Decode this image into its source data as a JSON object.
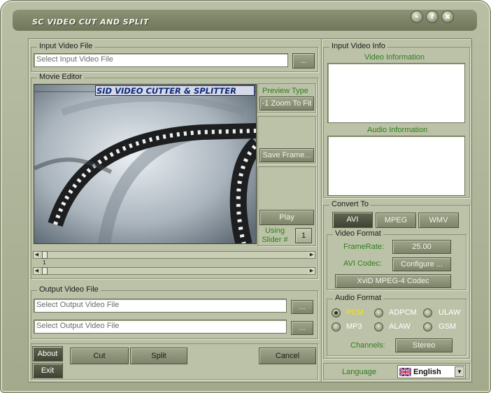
{
  "window": {
    "title": "SC VIDEO CUT AND SPLIT",
    "controls": {
      "minimize": "-",
      "help": "?",
      "close": "x"
    }
  },
  "input": {
    "group_label": "Input Video File",
    "placeholder": "Select Input Video File",
    "browse_label": "..."
  },
  "editor": {
    "group_label": "Movie Editor",
    "banner": "SID VIDEO CUTTER & SPLITTER",
    "preview_type_label": "Preview Type",
    "zoom_value": "-1 Zoom To Fit",
    "save_frame_label": "Save Frame...",
    "play_label": "Play",
    "using_slider_label": "Using Slider #",
    "slider_number": "1",
    "slider_position_marker": "1"
  },
  "output": {
    "group_label": "Output Video File",
    "placeholder_1": "Select Output Video File",
    "placeholder_2": "Select Output Video File",
    "browse_label": "..."
  },
  "actions": {
    "about": "About",
    "exit": "Exit",
    "cut": "Cut",
    "split": "Split",
    "cancel": "Cancel"
  },
  "info": {
    "group_label": "Input Video Info",
    "video_info_label": "Video Information",
    "audio_info_label": "Audio Information"
  },
  "convert": {
    "group_label": "Convert To",
    "formats": [
      "AVI",
      "MPEG",
      "WMV"
    ],
    "selected": "AVI",
    "video_format_label": "Video Format",
    "framerate_label": "FrameRate:",
    "framerate_value": "25.00",
    "codec_label": "AVI Codec:",
    "configure_label": "Configure ...",
    "codec_name": "XviD MPEG-4 Codec",
    "audio_format_label": "Audio Format",
    "audio_options": [
      "PCM",
      "ADPCM",
      "ULAW",
      "MP3",
      "ALAW",
      "GSM"
    ],
    "audio_selected": "PCM",
    "channels_label": "Channels:",
    "channels_value": "Stereo"
  },
  "language": {
    "label": "Language",
    "value": "English"
  },
  "colors": {
    "green_label": "#2e7d1e",
    "selected_radio_text": "#f5e400"
  }
}
